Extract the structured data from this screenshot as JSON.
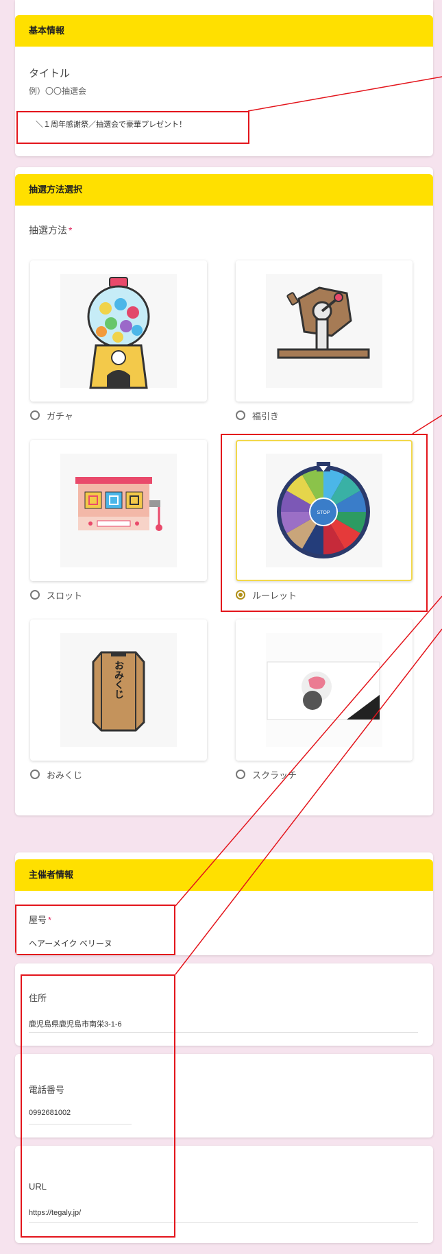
{
  "basic": {
    "header": "基本情報",
    "title_label": "タイトル",
    "title_hint": "例）〇〇抽選会",
    "title_value": "＼１周年感謝祭／抽選会で豪華プレゼント！"
  },
  "method": {
    "header": "抽選方法選択",
    "label": "抽選方法",
    "required_mark": "*",
    "options": [
      {
        "label": "ガチャ",
        "selected": false
      },
      {
        "label": "福引き",
        "selected": false
      },
      {
        "label": "スロット",
        "selected": false
      },
      {
        "label": "ルーレット",
        "selected": true
      },
      {
        "label": "おみくじ",
        "selected": false
      },
      {
        "label": "スクラッチ",
        "selected": false
      }
    ],
    "roulette_stop": "STOP",
    "omikuji_text": "おみくじ"
  },
  "organizer": {
    "header": "主催者情報",
    "shop_label": "屋号",
    "required_mark": "*",
    "shop_value": "ヘアーメイク ベリーヌ",
    "address_label": "住所",
    "address_value": "鹿児島県鹿児島市南栄3-1-6",
    "phone_label": "電話番号",
    "phone_value": "0992681002",
    "url_label": "URL",
    "url_value": "https://tegaly.jp/"
  },
  "colors": {
    "header_bg": "#ffe000",
    "page_bg": "#f6e3ee",
    "annotation_red": "#e3141b",
    "selected_radio": "#b08f17"
  }
}
